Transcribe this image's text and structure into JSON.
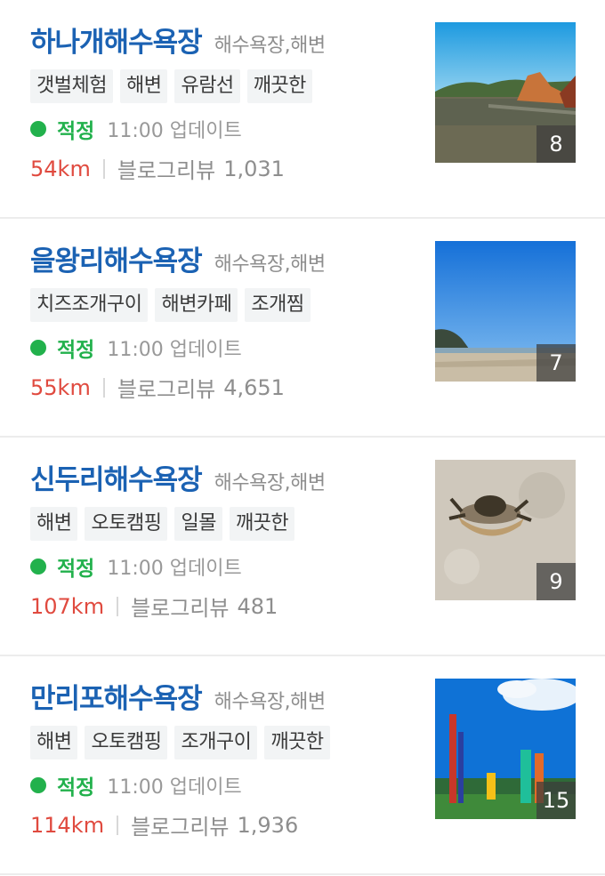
{
  "status_color": "#22b14c",
  "title_color": "#1b62b3",
  "distance_color": "#e04a3f",
  "beaches": [
    {
      "name": "하나개해수욕장",
      "category": "해수욕장,해변",
      "tags": [
        "갯벌체험",
        "해변",
        "유람선",
        "깨끗한"
      ],
      "status": "적정",
      "update_time": "11:00 업데이트",
      "distance": "54km",
      "blog_label": "블로그리뷰",
      "blog_count": "1,031",
      "photo_count": "8",
      "photo_icon": "beach-rock-photo"
    },
    {
      "name": "을왕리해수욕장",
      "category": "해수욕장,해변",
      "tags": [
        "치즈조개구이",
        "해변카페",
        "조개찜"
      ],
      "status": "적정",
      "update_time": "11:00 업데이트",
      "distance": "55km",
      "blog_label": "블로그리뷰",
      "blog_count": "4,651",
      "photo_count": "7",
      "photo_icon": "beach-sky-photo"
    },
    {
      "name": "신두리해수욕장",
      "category": "해수욕장,해변",
      "tags": [
        "해변",
        "오토캠핑",
        "일몰",
        "깨끗한"
      ],
      "status": "적정",
      "update_time": "11:00 업데이트",
      "distance": "107km",
      "blog_label": "블로그리뷰",
      "blog_count": "481",
      "photo_count": "9",
      "photo_icon": "crab-sand-photo"
    },
    {
      "name": "만리포해수욕장",
      "category": "해수욕장,해변",
      "tags": [
        "해변",
        "오토캠핑",
        "조개구이",
        "깨끗한"
      ],
      "status": "적정",
      "update_time": "11:00 업데이트",
      "distance": "114km",
      "blog_label": "블로그리뷰",
      "blog_count": "1,936",
      "photo_count": "15",
      "photo_icon": "beach-flags-photo"
    }
  ]
}
